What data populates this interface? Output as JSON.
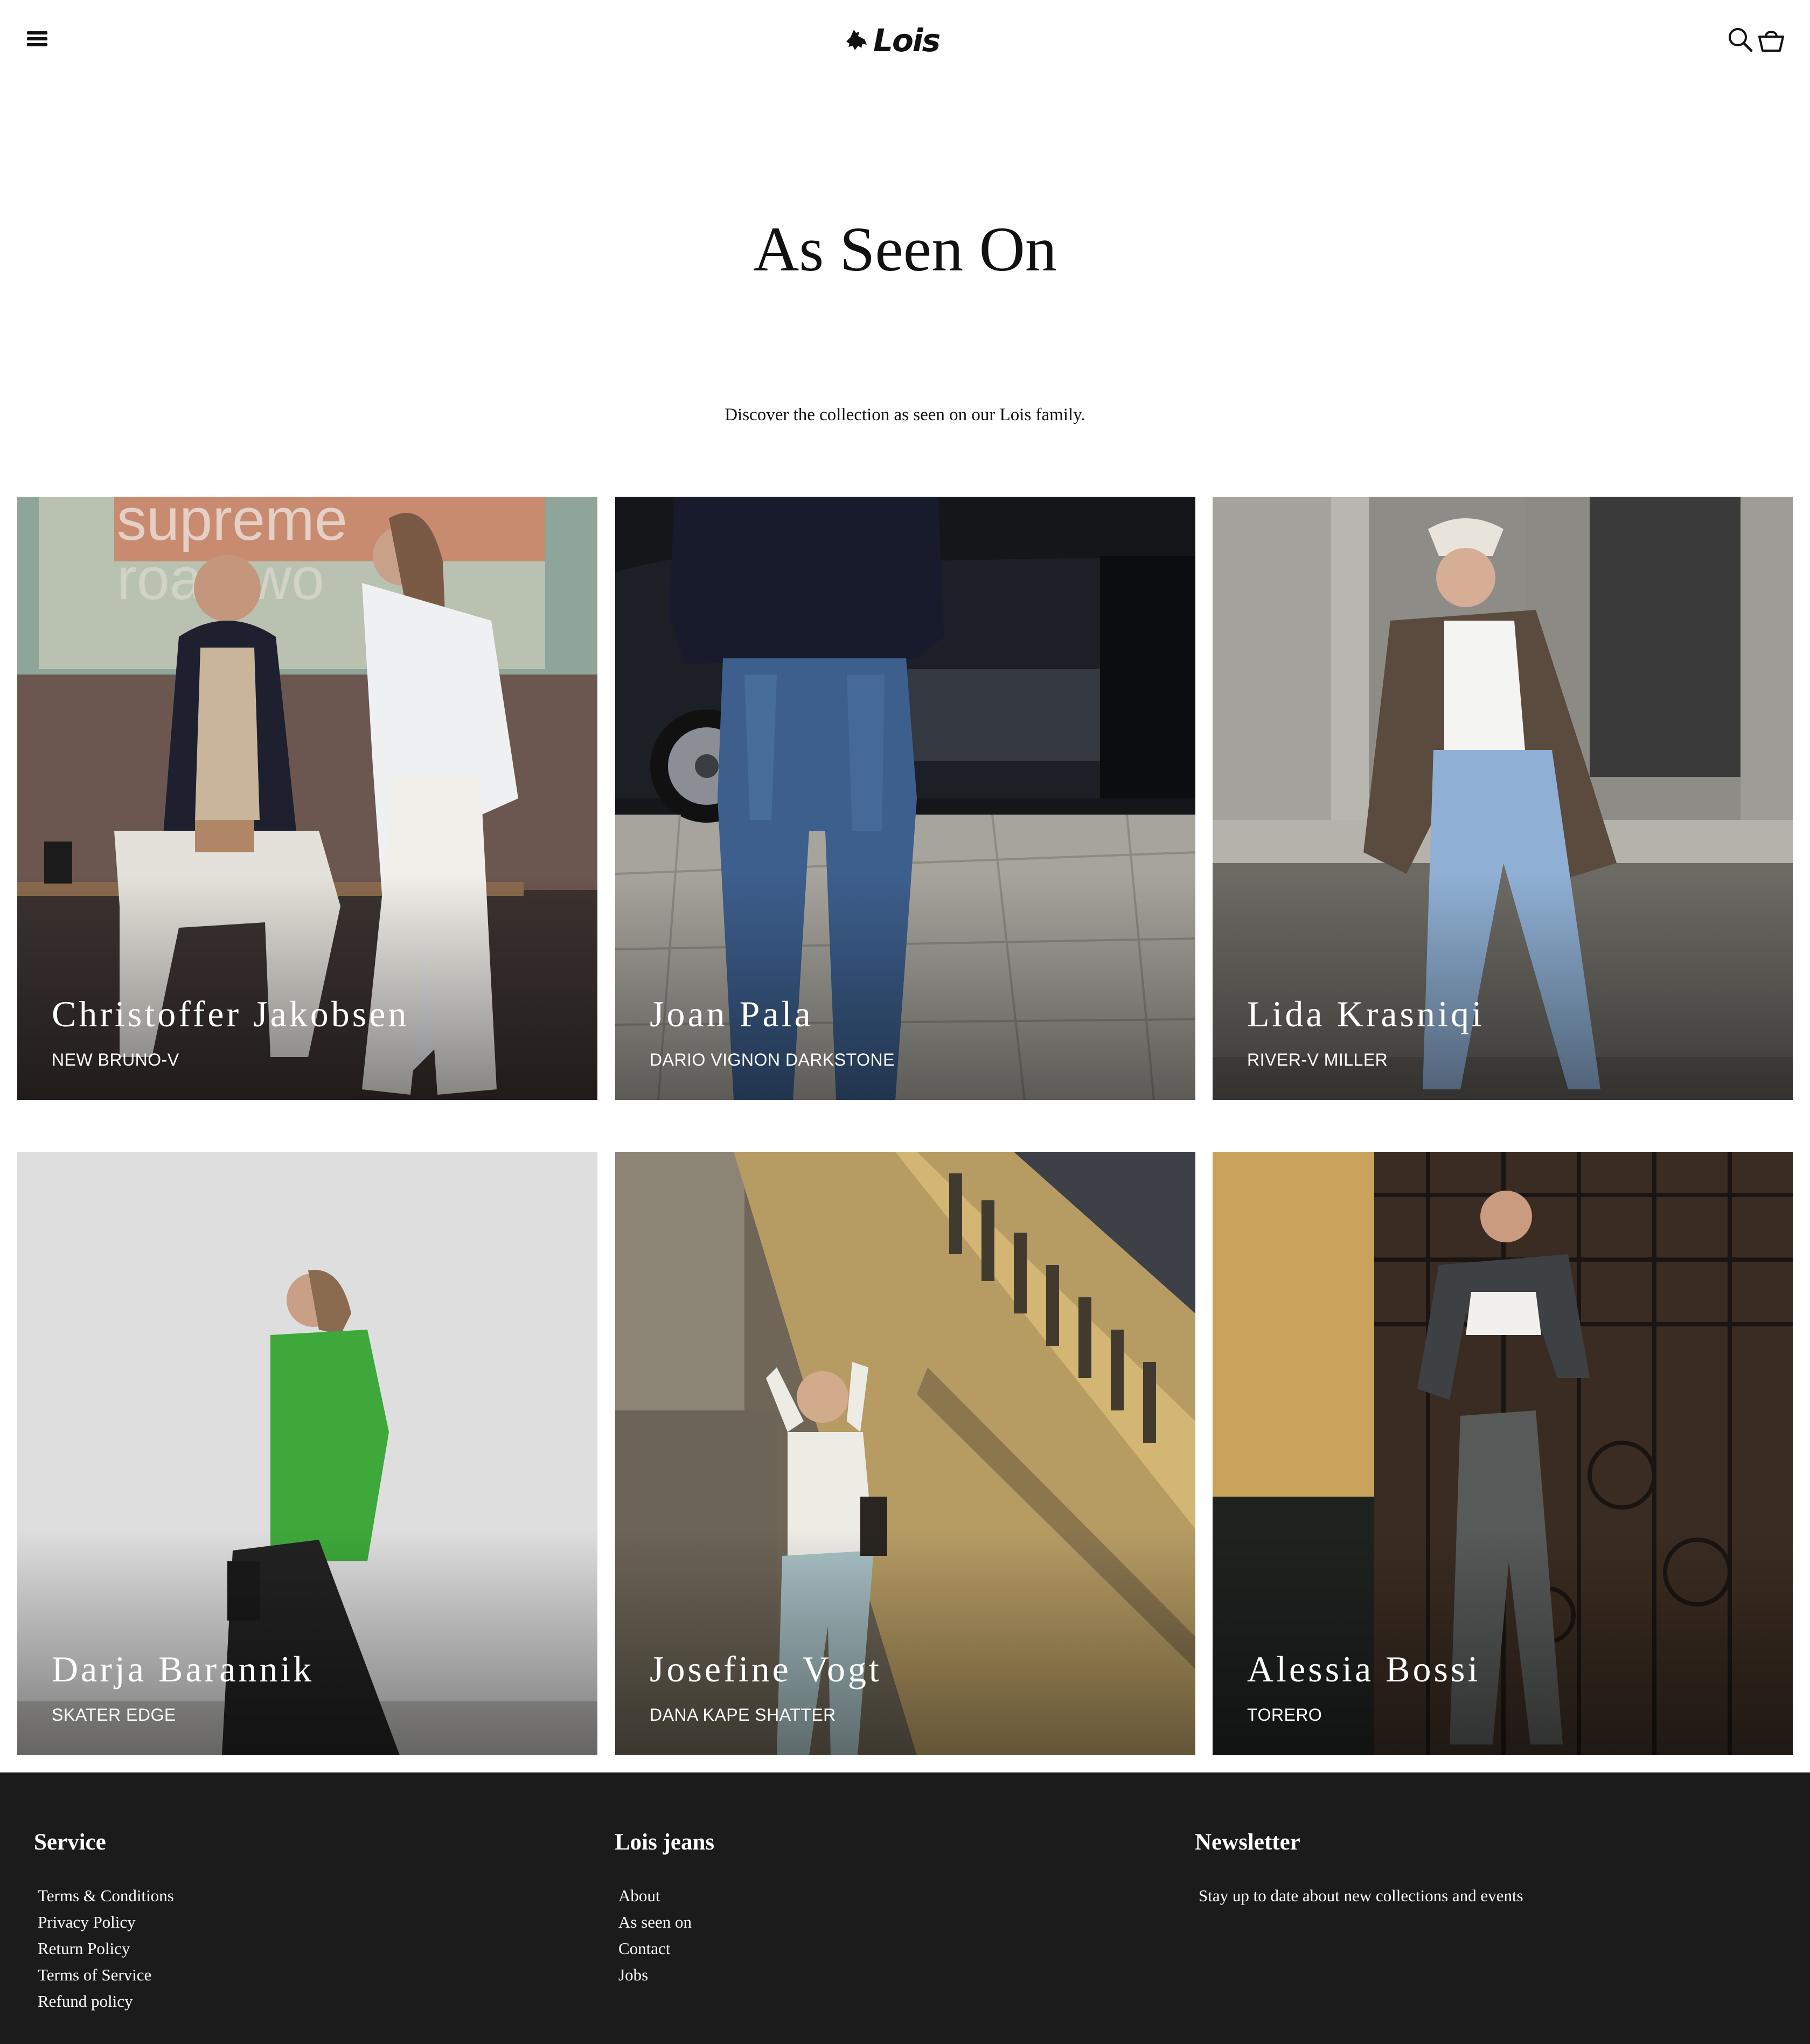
{
  "header": {
    "logo_text": "Lois",
    "menu_icon": "hamburger-menu-icon",
    "search_icon": "search-icon",
    "cart_icon": "basket-icon"
  },
  "page": {
    "title": "As Seen On",
    "intro": "Discover the collection as seen on our Lois family."
  },
  "cards": [
    {
      "name": "Christoffer Jakobsen",
      "product": "NEW BRUNO-V"
    },
    {
      "name": "Joan Pala",
      "product": "DARIO VIGNON DARKSTONE"
    },
    {
      "name": "Lida Krasniqi",
      "product": "RIVER-V MILLER"
    },
    {
      "name": "Darja Barannik",
      "product": "SKATER EDGE"
    },
    {
      "name": "Josefine Vogt",
      "product": "DANA KAPE SHATTER"
    },
    {
      "name": "Alessia Bossi",
      "product": "TORERO"
    }
  ],
  "footer": {
    "service": {
      "heading": "Service",
      "links": [
        "Terms & Conditions",
        "Privacy Policy",
        "Return Policy",
        "Terms of Service",
        "Refund policy"
      ]
    },
    "lois_jeans": {
      "heading": "Lois jeans",
      "links": [
        "About",
        "As seen on",
        "Contact",
        "Jobs"
      ]
    },
    "newsletter": {
      "heading": "Newsletter",
      "text": "Stay up to date about new collections and events"
    }
  },
  "colors": {
    "footer_bg": "#1c1b1b",
    "text": "#111111",
    "overlay_text": "#ffffff"
  }
}
